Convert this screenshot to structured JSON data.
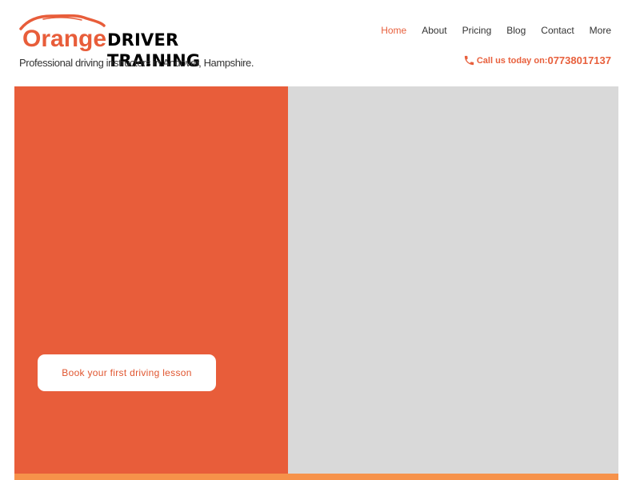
{
  "brand": {
    "name_orange": "Orange",
    "name_rest": "DRIVER TRAINING",
    "tagline": "Professional driving instructors in Andover, Hampshire."
  },
  "nav": {
    "items": [
      {
        "label": "Home",
        "active": true
      },
      {
        "label": "About"
      },
      {
        "label": "Pricing"
      },
      {
        "label": "Blog"
      },
      {
        "label": "Contact"
      },
      {
        "label": "More"
      }
    ]
  },
  "contact": {
    "icon": "phone-icon",
    "label": "Call us today on:",
    "number": "07738017137"
  },
  "hero": {
    "cta_label": "Book your first driving lesson"
  },
  "colors": {
    "accent": "#e85d3a",
    "hero_left": "#e85d3a",
    "hero_right": "#d9d9d9",
    "bottom_bar": "#f6924a"
  }
}
